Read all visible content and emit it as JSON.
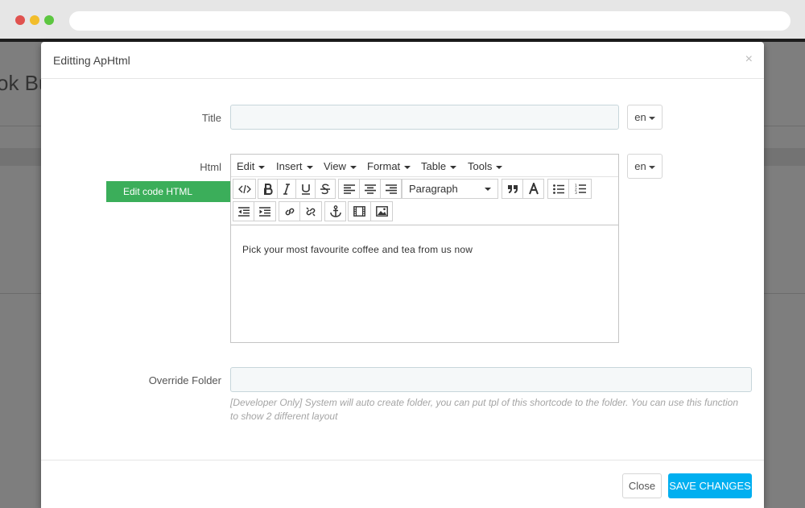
{
  "background": {
    "heading": "ok Bu"
  },
  "modal": {
    "title": "Editting ApHtml",
    "close_symbol": "×"
  },
  "form": {
    "title_label": "Title",
    "title_value": "",
    "title_lang": "en",
    "html_label": "Html",
    "html_lang": "en",
    "edit_code_label": "Edit code HTML",
    "override_label": "Override Folder",
    "override_value": "",
    "help_text": "[Developer Only] System will auto create folder, you can put tpl of this shortcode to the folder. You can use this function to show 2 different layout"
  },
  "editor": {
    "menus": [
      {
        "label": "Edit"
      },
      {
        "label": "Insert"
      },
      {
        "label": "View"
      },
      {
        "label": "Format"
      },
      {
        "label": "Table"
      },
      {
        "label": "Tools"
      }
    ],
    "block_format": "Paragraph",
    "content": "Pick your most favourite coffee and tea from us now"
  },
  "footer": {
    "close_label": "Close",
    "save_label": "SAVE CHANGES"
  },
  "colors": {
    "accent_green": "#3bae5a",
    "primary_blue": "#00aff0"
  }
}
